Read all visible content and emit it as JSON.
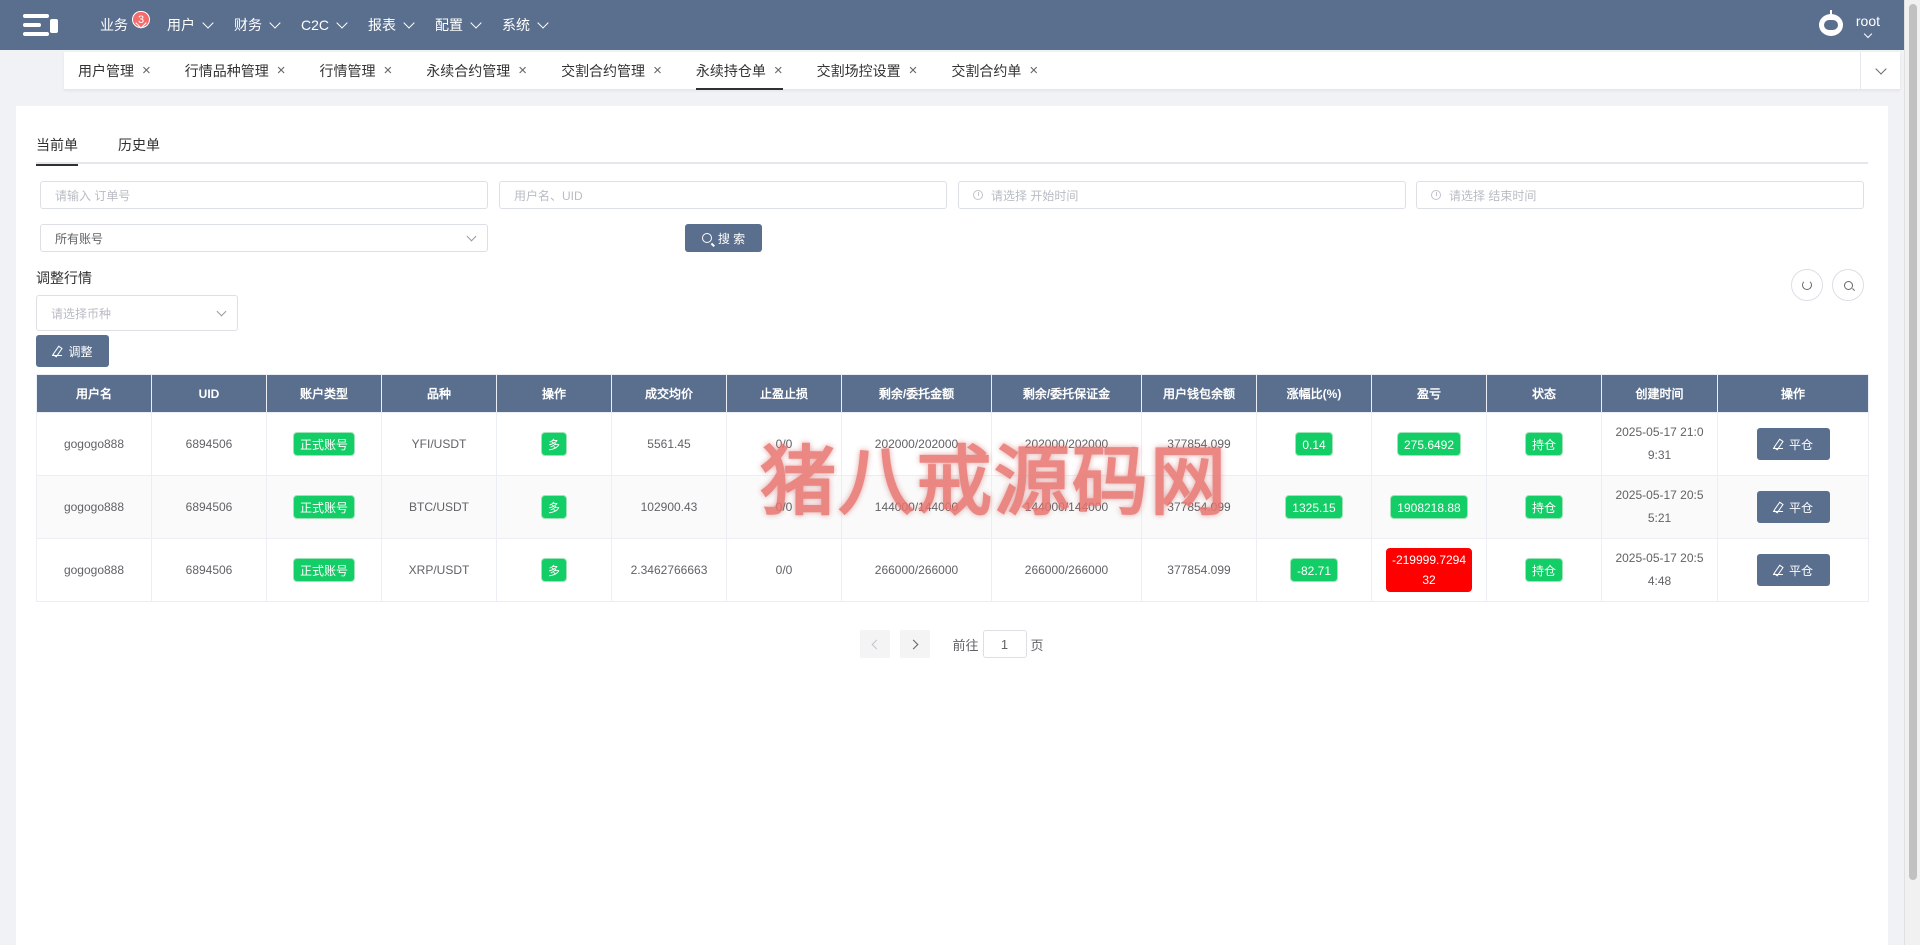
{
  "nav": {
    "items": [
      {
        "label": "业务",
        "badge": "3"
      },
      {
        "label": "用户"
      },
      {
        "label": "财务"
      },
      {
        "label": "C2C"
      },
      {
        "label": "报表"
      },
      {
        "label": "配置"
      },
      {
        "label": "系统"
      }
    ],
    "user": "root"
  },
  "tags": [
    {
      "label": "用户管理"
    },
    {
      "label": "行情品种管理"
    },
    {
      "label": "行情管理"
    },
    {
      "label": "永续合约管理"
    },
    {
      "label": "交割合约管理"
    },
    {
      "label": "永续持仓单",
      "active": true
    },
    {
      "label": "交割场控设置"
    },
    {
      "label": "交割合约单"
    }
  ],
  "tabs": [
    {
      "label": "当前单",
      "active": true
    },
    {
      "label": "历史单"
    }
  ],
  "filters": {
    "order_placeholder": "请输入 订单号",
    "user_placeholder": "用户名、UID",
    "start_placeholder": "请选择 开始时间",
    "end_placeholder": "请选择 结束时间",
    "account_value": "所有账号",
    "search_label": "搜 索"
  },
  "adjust": {
    "title": "调整行情",
    "coin_placeholder": "请选择币种",
    "button_label": "调整"
  },
  "table": {
    "headers": [
      "用户名",
      "UID",
      "账户类型",
      "品种",
      "操作",
      "成交均价",
      "止盈止损",
      "剩余/委托金额",
      "剩余/委托保证金",
      "用户钱包余额",
      "涨幅比(%)",
      "盈亏",
      "状态",
      "创建时间",
      "操作"
    ],
    "rows": [
      {
        "username": "gogogo888",
        "uid": "6894506",
        "account_type": "正式账号",
        "symbol": "YFI/USDT",
        "direction": "多",
        "avg_price": "5561.45",
        "tp_sl": "0/0",
        "amount": "202000/202000",
        "margin": "202000/202000",
        "balance": "377854.099",
        "change": "0.14",
        "pnl": "275.6492",
        "pnl_negative": false,
        "status": "持仓",
        "created": "2025-05-17 21:09:31",
        "action": "平仓"
      },
      {
        "username": "gogogo888",
        "uid": "6894506",
        "account_type": "正式账号",
        "symbol": "BTC/USDT",
        "direction": "多",
        "avg_price": "102900.43",
        "tp_sl": "0/0",
        "amount": "144000/144000",
        "margin": "144000/144000",
        "balance": "377854.099",
        "change": "1325.15",
        "pnl": "1908218.88",
        "pnl_negative": false,
        "status": "持仓",
        "created": "2025-05-17 20:55:21",
        "action": "平仓"
      },
      {
        "username": "gogogo888",
        "uid": "6894506",
        "account_type": "正式账号",
        "symbol": "XRP/USDT",
        "direction": "多",
        "avg_price": "2.3462766663",
        "tp_sl": "0/0",
        "amount": "266000/266000",
        "margin": "266000/266000",
        "balance": "377854.099",
        "change": "-82.71",
        "pnl": "-219999.729432",
        "pnl_negative": true,
        "status": "持仓",
        "created": "2025-05-17 20:54:48",
        "action": "平仓"
      }
    ]
  },
  "pager": {
    "goto_label": "前往",
    "page": "1",
    "page_suffix": "页"
  },
  "watermark": "猪八戒源码网",
  "colors": {
    "primary": "#5a6f8e",
    "success": "#13ce66",
    "danger": "#ff0000"
  }
}
